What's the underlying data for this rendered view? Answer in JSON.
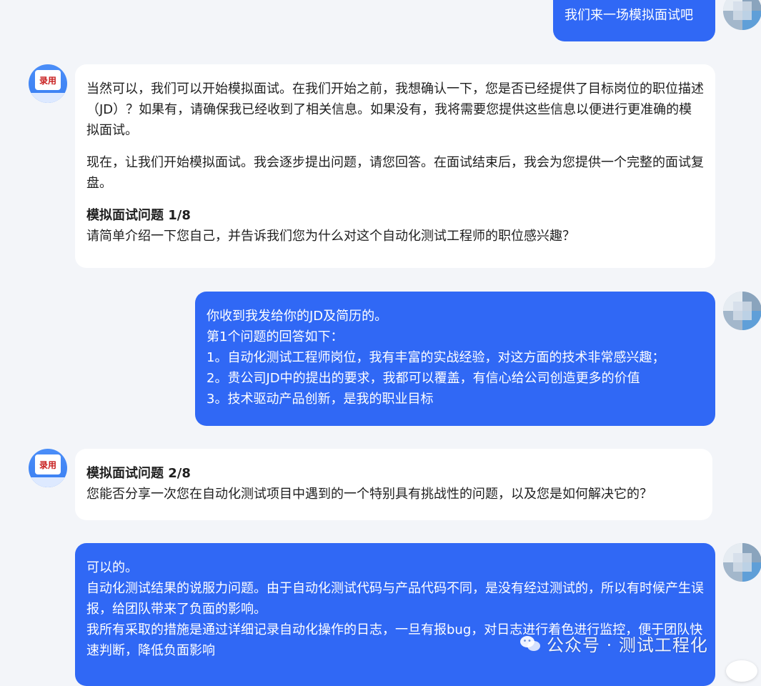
{
  "messages": {
    "user1": {
      "text": "我们来一场模拟面试吧"
    },
    "bot1": {
      "para1": "当然可以，我们可以开始模拟面试。在我们开始之前，我想确认一下，您是否已经提供了目标岗位的职位描述（JD）？如果有，请确保我已经收到了相关信息。如果没有，我将需要您提供这些信息以便进行更准确的模拟面试。",
      "para2": "现在，让我们开始模拟面试。我会逐步提出问题，请您回答。在面试结束后，我会为您提供一个完整的面试复盘。",
      "question_title": "模拟面试问题 1/8",
      "question_text": "请简单介绍一下您自己，并告诉我们您为什么对这个自动化测试工程师的职位感兴趣？"
    },
    "user2": {
      "line1": "你收到我发给你的JD及简历的。",
      "line2": "第1个问题的回答如下：",
      "line3": "1。自动化测试工程师岗位，我有丰富的实战经验，对这方面的技术非常感兴趣；",
      "line4": "2。贵公司JD中的提出的要求，我都可以覆盖，有信心给公司创造更多的价值",
      "line5": "3。技术驱动产品创新，是我的职业目标"
    },
    "bot2": {
      "question_title": "模拟面试问题 2/8",
      "question_text": "您能否分享一次您在自动化测试项目中遇到的一个特别具有挑战性的问题，以及您是如何解决它的？"
    },
    "user3": {
      "line1": "可以的。",
      "line2": "自动化测试结果的说服力问题。由于自动化测试代码与产品代码不同，是没有经过测试的，所以有时候产生误报，给团队带来了负面的影响。",
      "line3": "我所有采取的措施是通过详细记录自动化操作的日志，一旦有报bug，对日志进行着色进行监控，便于团队快速判断，降低负面影响"
    }
  },
  "bot_avatar_label": "录用",
  "watermark": {
    "text": "公众号 · 测试工程化",
    "icon": "wechat-icon"
  },
  "colors": {
    "user_bubble": "#3068f5",
    "bot_bubble": "#ffffff",
    "background": "#f3f5f9"
  }
}
